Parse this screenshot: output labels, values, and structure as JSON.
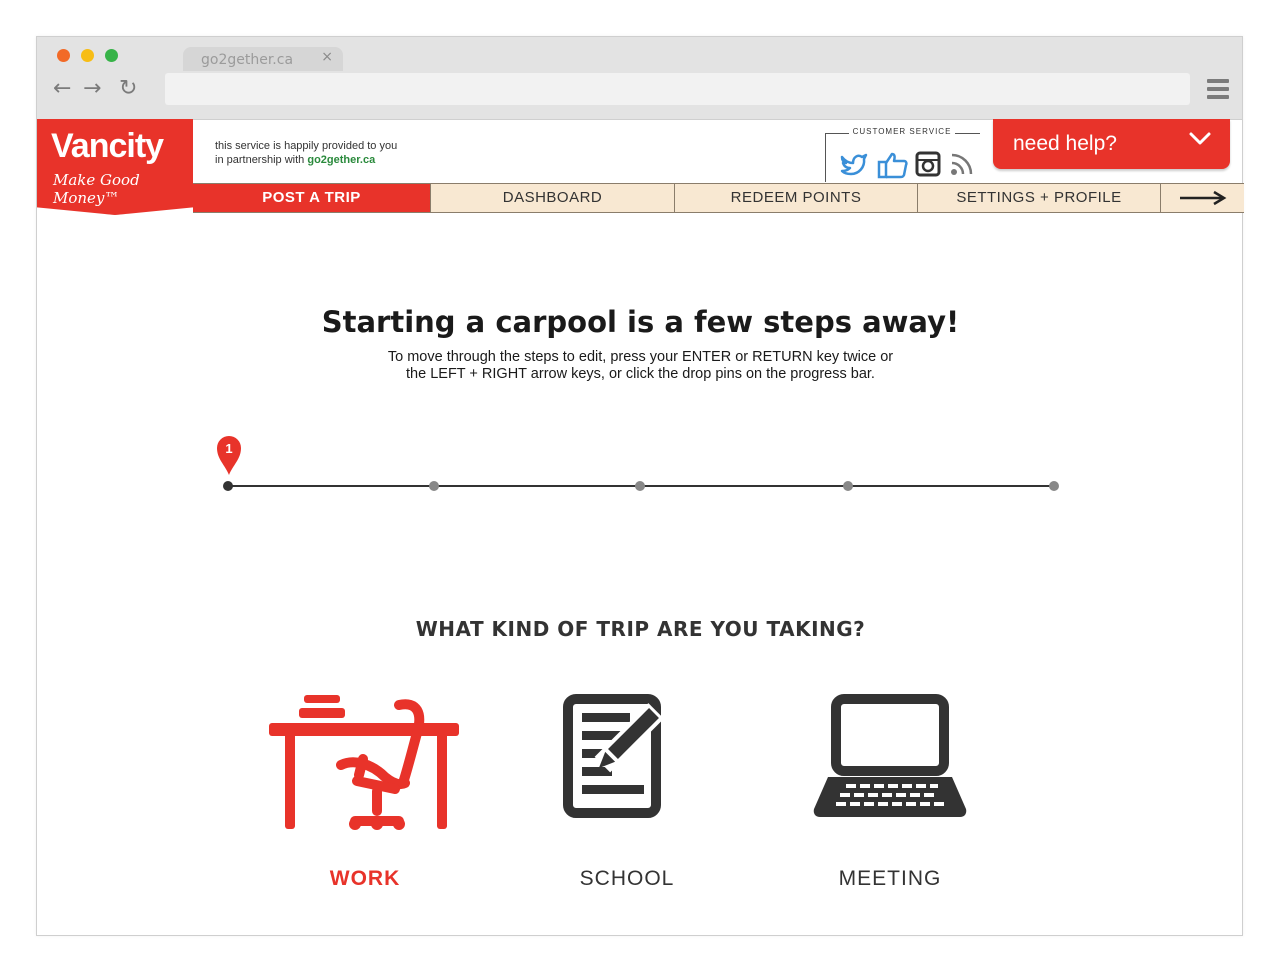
{
  "browser": {
    "tab_title": "go2gether.ca",
    "tab_close": "×",
    "back_glyph": "←",
    "forward_glyph": "→",
    "reload_glyph": "↻",
    "url": ""
  },
  "brand": {
    "name": "Vancity",
    "tagline": "Make Good Money™",
    "accent_color": "#e8332a"
  },
  "partner": {
    "line1": "this service is happily provided to you",
    "line2_prefix": "in partnership with",
    "link": "go2gether.ca"
  },
  "customer_service": {
    "label": "CUSTOMER SERVICE",
    "icons": [
      "twitter-icon",
      "facebook-like-icon",
      "instagram-icon",
      "rss-icon"
    ]
  },
  "help": {
    "label": "need help?",
    "chevron": "chevron-down-icon"
  },
  "nav": {
    "items": [
      {
        "label": "POST A TRIP",
        "active": true
      },
      {
        "label": "DASHBOARD",
        "active": false
      },
      {
        "label": "REDEEM POINTS",
        "active": false
      },
      {
        "label": "SETTINGS + PROFILE",
        "active": false
      }
    ],
    "next_icon": "arrow-right-icon"
  },
  "main": {
    "headline": "Starting a carpool is a few steps away!",
    "instructions_line1": "To move through the steps to edit, press your ENTER or RETURN key twice or",
    "instructions_line2": "the LEFT + RIGHT arrow keys, or click the drop pins on the progress bar.",
    "question": "WHAT KIND OF TRIP ARE YOU TAKING?"
  },
  "progress": {
    "current_step": "1",
    "total_steps": 5
  },
  "trip_types": [
    {
      "label": "WORK",
      "icon": "desk-chair-icon",
      "selected": true
    },
    {
      "label": "SCHOOL",
      "icon": "notepad-pencil-icon",
      "selected": false
    },
    {
      "label": "MEETING",
      "icon": "laptop-icon",
      "selected": false
    }
  ]
}
